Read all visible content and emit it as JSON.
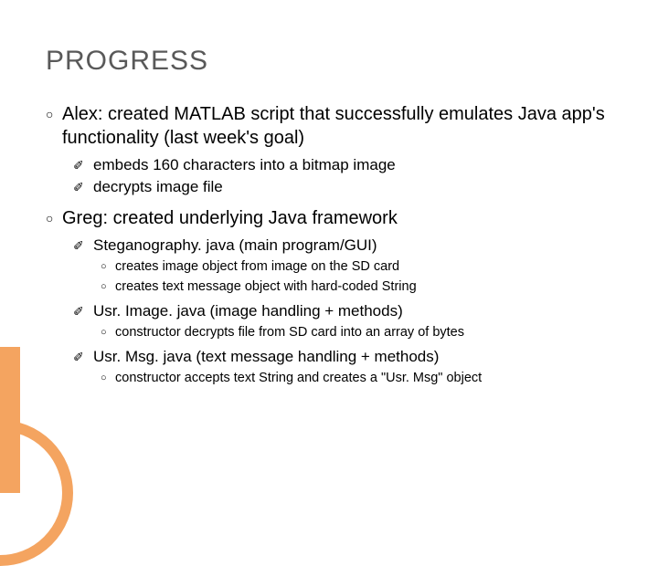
{
  "title": "PROGRESS",
  "marks": {
    "l1": "○",
    "l2": "✐",
    "l3": "○"
  },
  "items": [
    {
      "level": 1,
      "text": "Alex: created MATLAB script that successfully emulates Java app's functionality (last week's goal)"
    },
    {
      "level": 2,
      "text": "embeds 160 characters into a bitmap image"
    },
    {
      "level": 2,
      "text": "decrypts image file"
    },
    {
      "level": 1,
      "text": "Greg: created underlying Java framework"
    },
    {
      "level": 2,
      "text": "Steganography. java (main program/GUI)"
    },
    {
      "level": 3,
      "text": "creates image object from image on the SD card"
    },
    {
      "level": 3,
      "text": "creates text message object with hard-coded String"
    },
    {
      "level": 2,
      "text": "Usr. Image. java (image handling + methods)"
    },
    {
      "level": 3,
      "text": "constructor decrypts file from SD card into an array of bytes"
    },
    {
      "level": 2,
      "text": "Usr. Msg. java (text message handling + methods)"
    },
    {
      "level": 3,
      "text": "constructor accepts text String and creates a \"Usr. Msg\" object"
    }
  ]
}
